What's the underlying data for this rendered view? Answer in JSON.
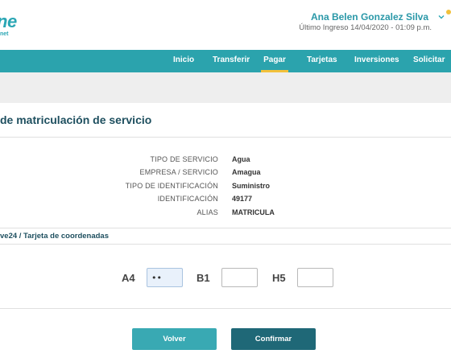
{
  "brand": {
    "logo_text": "ne",
    "logo_subtext": "net",
    "accent": "#2aa6b4",
    "nav_bg": "#2ba3ad",
    "highlight": "#f2c13b",
    "confirm_bg": "#1f6877"
  },
  "user": {
    "name": "Ana Belen Gonzalez Silva",
    "last_login": "Último Ingreso 14/04/2020 - 01:09 p.m.",
    "menu_icon": "chevron-down-icon",
    "notification_icon": "notification-dot-icon"
  },
  "nav": {
    "items": [
      {
        "label": "Inicio"
      },
      {
        "label": "Transferir"
      },
      {
        "label": "Pagar",
        "active": true
      },
      {
        "label": "Tarjetas"
      },
      {
        "label": "Inversiones"
      },
      {
        "label": "Solicitar"
      }
    ]
  },
  "page": {
    "title": "de matriculación de servicio"
  },
  "details": {
    "rows": [
      {
        "label": "TIPO DE SERVICIO",
        "value": "Agua"
      },
      {
        "label": "EMPRESA / SERVICIO",
        "value": "Amagua"
      },
      {
        "label": "TIPO DE IDENTIFICACIÓN",
        "value": "Suministro"
      },
      {
        "label": "IDENTIFICACIÓN",
        "value": "49177"
      },
      {
        "label": "ALIAS",
        "value": "MATRICULA"
      }
    ]
  },
  "security": {
    "section_label": "ve24 / Tarjeta de coordenadas",
    "coordinates": [
      {
        "label": "A4",
        "value": "••"
      },
      {
        "label": "B1",
        "value": ""
      },
      {
        "label": "H5",
        "value": ""
      }
    ]
  },
  "actions": {
    "back_label": "Volver",
    "confirm_label": "Confirmar"
  }
}
